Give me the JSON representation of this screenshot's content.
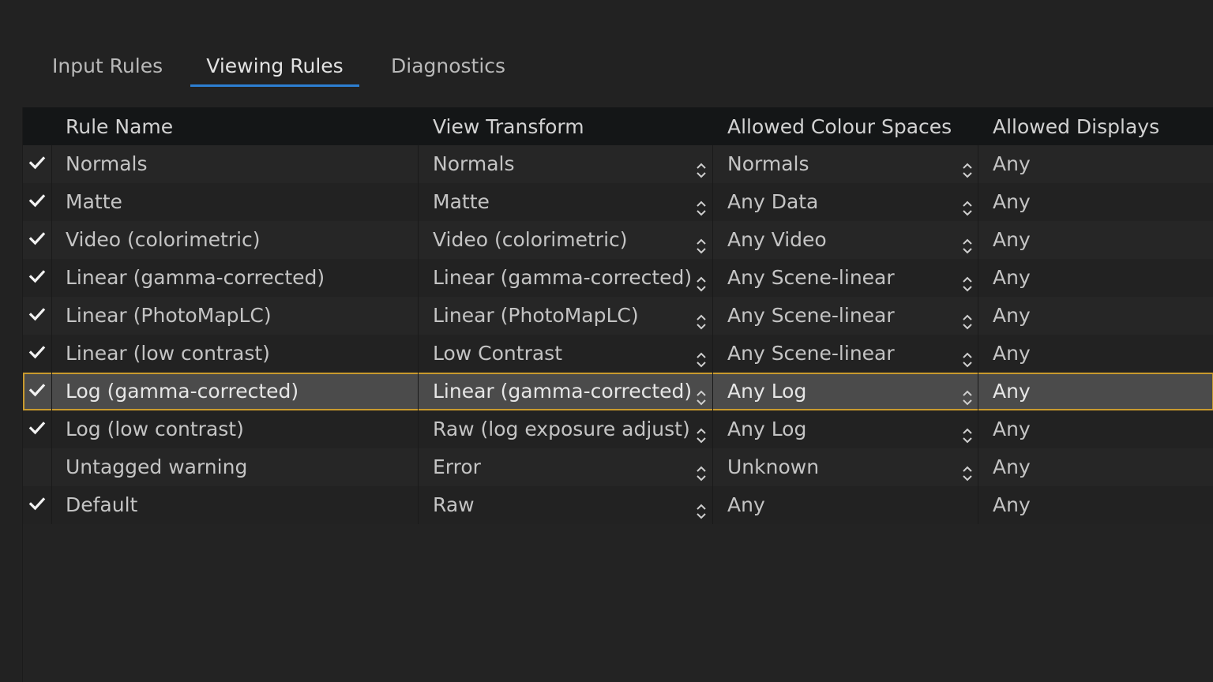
{
  "tabs": [
    {
      "label": "Input Rules",
      "active": false
    },
    {
      "label": "Viewing Rules",
      "active": true
    },
    {
      "label": "Diagnostics",
      "active": false
    }
  ],
  "table": {
    "columns": [
      "Rule Name",
      "View Transform",
      "Allowed Colour Spaces",
      "Allowed Displays"
    ],
    "selected_row": 6,
    "rows": [
      {
        "enabled": true,
        "name": "Normals",
        "view_transform": "Normals",
        "colour_spaces": "Normals",
        "colour_spaces_combo": true,
        "displays": "Any"
      },
      {
        "enabled": true,
        "name": "Matte",
        "view_transform": "Matte",
        "colour_spaces": "Any Data",
        "colour_spaces_combo": true,
        "displays": "Any"
      },
      {
        "enabled": true,
        "name": "Video (colorimetric)",
        "view_transform": "Video (colorimetric)",
        "colour_spaces": "Any Video",
        "colour_spaces_combo": true,
        "displays": "Any"
      },
      {
        "enabled": true,
        "name": "Linear (gamma-corrected)",
        "view_transform": "Linear (gamma-corrected)",
        "colour_spaces": "Any Scene-linear",
        "colour_spaces_combo": true,
        "displays": "Any"
      },
      {
        "enabled": true,
        "name": "Linear (PhotoMapLC)",
        "view_transform": "Linear (PhotoMapLC)",
        "colour_spaces": "Any Scene-linear",
        "colour_spaces_combo": true,
        "displays": "Any"
      },
      {
        "enabled": true,
        "name": "Linear (low contrast)",
        "view_transform": "Low Contrast",
        "colour_spaces": "Any Scene-linear",
        "colour_spaces_combo": true,
        "displays": "Any"
      },
      {
        "enabled": true,
        "name": "Log (gamma-corrected)",
        "view_transform": "Linear (gamma-corrected)",
        "colour_spaces": "Any Log",
        "colour_spaces_combo": true,
        "displays": "Any"
      },
      {
        "enabled": true,
        "name": "Log (low contrast)",
        "view_transform": "Raw (log exposure adjust)",
        "colour_spaces": "Any Log",
        "colour_spaces_combo": true,
        "displays": "Any"
      },
      {
        "enabled": false,
        "name": "Untagged warning",
        "view_transform": "Error",
        "colour_spaces": "Unknown",
        "colour_spaces_combo": true,
        "displays": "Any"
      },
      {
        "enabled": true,
        "name": "Default",
        "view_transform": "Raw",
        "colour_spaces": "Any",
        "colour_spaces_combo": false,
        "displays": "Any"
      }
    ]
  },
  "icons": {
    "check": "checkmark-icon",
    "spinner": "updown-arrows-icon"
  },
  "colors": {
    "background": "#222222",
    "header_bg": "#141617",
    "tab_underline": "#2d7fd2",
    "selection_outline": "#c99a2e",
    "selection_bg": "#4b4b4b"
  }
}
